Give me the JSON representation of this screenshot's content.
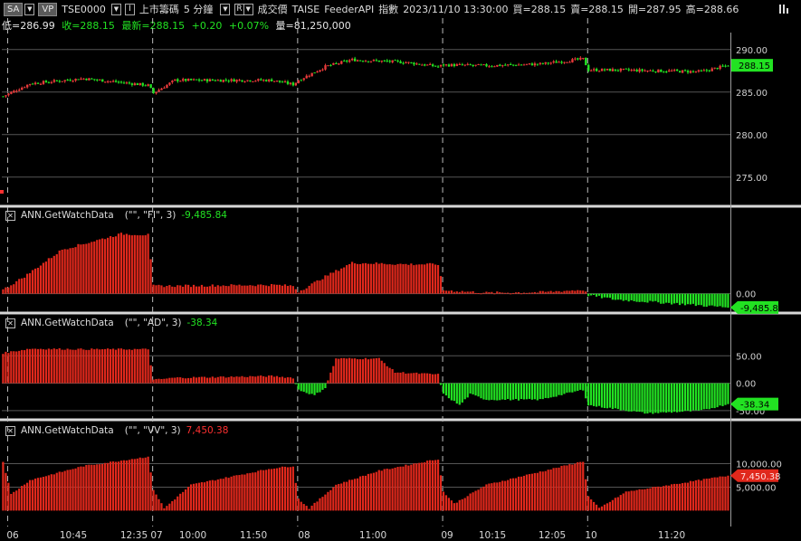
{
  "toolbar": {
    "sa_label": "SA",
    "vp_label": "VP",
    "symbol": "TSE0000",
    "i_label": "I",
    "market_name": "上市籌碼",
    "interval": "5 分鐘",
    "r_label": "R",
    "price_type": "成交價",
    "source": "TAISE",
    "feeder": "FeederAPI",
    "index_label": "指數",
    "datetime": "2023/11/10  13:30:00",
    "bid": "買=288.15",
    "ask": "賣=288.15",
    "open": "開=287.95",
    "high": "高=288.66",
    "menu_icon": "bars-icon"
  },
  "quote": {
    "low": "低=286.99",
    "close": "收=288.15",
    "last": "最新=288.15",
    "change": "+0.20",
    "change_pct": "+0.07%",
    "volume": "量=81,250,000"
  },
  "colors": {
    "up": "#e0281c",
    "down": "#22e222",
    "price_up": "#e83a3a",
    "price_down": "#22e222",
    "label_green": "#22e222",
    "label_red": "#ff3030",
    "divider": "#d8d8d8",
    "grid": "#555555",
    "vline": "#bbbbbb"
  },
  "price_panel": {
    "y_ticks": [
      "290.00",
      "285.00",
      "280.00",
      "275.00"
    ],
    "last_tag": "288.15"
  },
  "fi_panel": {
    "label": "ANN.GetWatchData",
    "args": "(\"\", \"FI\", 3)",
    "value": "-9,485.84",
    "y_ticks": [
      "0.00"
    ],
    "tag": "-9,485.84"
  },
  "ad_panel": {
    "label": "ANN.GetWatchData",
    "args": "(\"\", \"AD\", 3)",
    "value": "-38.34",
    "y_ticks": [
      "50.00",
      "0.00",
      "-50.00"
    ],
    "tag": "-38.34"
  },
  "vv_panel": {
    "label": "ANN.GetWatchData",
    "args": "(\"\", \"VV\", 3)",
    "value": "7,450.38",
    "y_ticks": [
      "10,000.00",
      "5,000.00"
    ],
    "tag": "7,450.38"
  },
  "x_axis": {
    "labels": [
      "06",
      "10:45",
      "12:35",
      "07",
      "10:00",
      "11:50",
      "08",
      "11:00",
      "09",
      "10:15",
      "12:05",
      "10",
      "11:20"
    ]
  },
  "chart_data": [
    {
      "type": "candlestick",
      "title": "TSE0000",
      "ylim": [
        272,
        292
      ],
      "session_bars": 54,
      "sessions": 5,
      "close_anchors": [
        [
          0,
          284.5
        ],
        [
          10,
          286
        ],
        [
          30,
          286.6
        ],
        [
          54,
          285.8
        ],
        [
          56,
          284.9
        ],
        [
          64,
          286.4
        ],
        [
          100,
          286.4
        ],
        [
          108,
          285.9
        ],
        [
          110,
          286.4
        ],
        [
          120,
          288.0
        ],
        [
          130,
          288.8
        ],
        [
          150,
          288.5
        ],
        [
          162,
          288.0
        ],
        [
          164,
          288.2
        ],
        [
          180,
          288.1
        ],
        [
          200,
          288.3
        ],
        [
          216,
          288.9
        ],
        [
          218,
          287.6
        ],
        [
          228,
          287.6
        ],
        [
          260,
          287.4
        ],
        [
          270,
          288.15
        ]
      ]
    },
    {
      "type": "bar",
      "series_name": "FI",
      "ylim": [
        -3200,
        14500
      ],
      "anchors": [
        [
          0,
          800
        ],
        [
          8,
          3500
        ],
        [
          22,
          9000
        ],
        [
          44,
          12200
        ],
        [
          54,
          12000
        ],
        [
          56,
          1600
        ],
        [
          64,
          1600
        ],
        [
          100,
          1800
        ],
        [
          108,
          1600
        ],
        [
          110,
          400
        ],
        [
          120,
          3500
        ],
        [
          130,
          6300
        ],
        [
          150,
          6000
        ],
        [
          162,
          6000
        ],
        [
          164,
          700
        ],
        [
          180,
          200
        ],
        [
          200,
          300
        ],
        [
          216,
          800
        ],
        [
          218,
          -300
        ],
        [
          228,
          -1200
        ],
        [
          250,
          -2000
        ],
        [
          270,
          -2800
        ]
      ]
    },
    {
      "type": "bar",
      "series_name": "AD",
      "ylim": [
        -60,
        95
      ],
      "anchors": [
        [
          0,
          55
        ],
        [
          10,
          63
        ],
        [
          30,
          62
        ],
        [
          54,
          62
        ],
        [
          56,
          6
        ],
        [
          64,
          10
        ],
        [
          100,
          13
        ],
        [
          108,
          10
        ],
        [
          110,
          -12
        ],
        [
          116,
          -22
        ],
        [
          120,
          -8
        ],
        [
          124,
          45
        ],
        [
          140,
          45
        ],
        [
          146,
          20
        ],
        [
          162,
          16
        ],
        [
          164,
          -20
        ],
        [
          170,
          -40
        ],
        [
          174,
          -20
        ],
        [
          180,
          -30
        ],
        [
          200,
          -30
        ],
        [
          216,
          -12
        ],
        [
          218,
          -40
        ],
        [
          240,
          -55
        ],
        [
          260,
          -50
        ],
        [
          270,
          -38
        ]
      ]
    },
    {
      "type": "bar",
      "series_name": "VV",
      "ylim": [
        -3000,
        15500
      ],
      "anchors": [
        [
          0,
          10500
        ],
        [
          3,
          3500
        ],
        [
          10,
          6500
        ],
        [
          30,
          9500
        ],
        [
          54,
          11500
        ],
        [
          56,
          4500
        ],
        [
          60,
          500
        ],
        [
          70,
          5500
        ],
        [
          100,
          9000
        ],
        [
          108,
          9500
        ],
        [
          110,
          2500
        ],
        [
          114,
          500
        ],
        [
          124,
          5500
        ],
        [
          140,
          8500
        ],
        [
          162,
          11000
        ],
        [
          164,
          4000
        ],
        [
          168,
          1500
        ],
        [
          180,
          5500
        ],
        [
          216,
          10500
        ],
        [
          218,
          3000
        ],
        [
          222,
          500
        ],
        [
          232,
          4000
        ],
        [
          270,
          7450
        ]
      ]
    }
  ]
}
